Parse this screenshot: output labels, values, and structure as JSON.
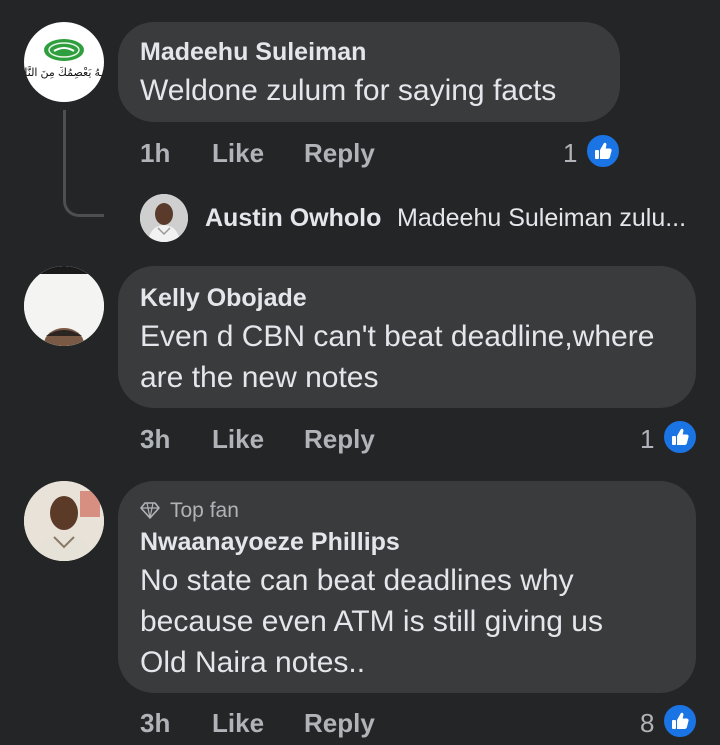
{
  "comments": [
    {
      "author": "Madeehu Suleiman",
      "text": "Weldone zulum for saying facts",
      "time": "1h",
      "like_label": "Like",
      "reply_label": "Reply",
      "reactions": "1",
      "avatar": {
        "type": "logo",
        "caption": "ـهُ يَعْصِمُكَ مِنَ النَّا"
      },
      "reply_preview": {
        "author": "Austin Owholo",
        "text": "Madeehu Suleiman zulu..."
      }
    },
    {
      "author": "Kelly Obojade",
      "lines": [
        "Even d CBN can't beat deadline,where",
        "are the new notes"
      ],
      "time": "3h",
      "like_label": "Like",
      "reply_label": "Reply",
      "reactions": "1"
    },
    {
      "badge": "Top fan",
      "author": "Nwaanayoeze Phillips",
      "lines": [
        "No state can beat deadlines why",
        "because even ATM is still giving us",
        "Old Naira notes.."
      ],
      "time": "3h",
      "like_label": "Like",
      "reply_label": "Reply",
      "reactions": "8"
    }
  ],
  "colors": {
    "background": "#242526",
    "bubble": "#3a3b3c",
    "like_blue": "#1b74e4"
  }
}
